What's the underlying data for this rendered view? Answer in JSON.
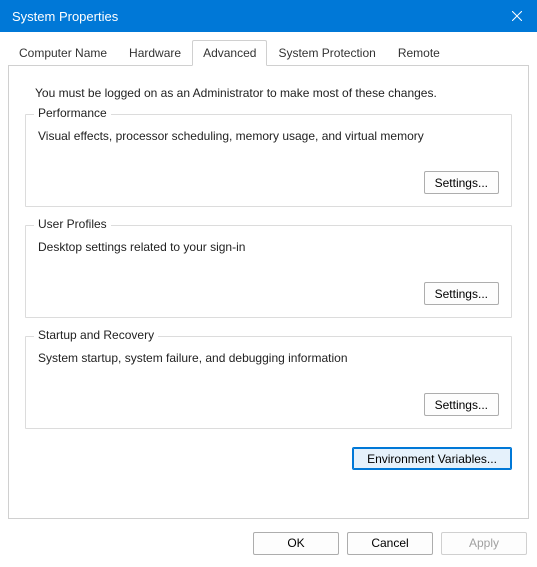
{
  "window": {
    "title": "System Properties"
  },
  "tabs": [
    {
      "label": "Computer Name"
    },
    {
      "label": "Hardware"
    },
    {
      "label": "Advanced",
      "active": true
    },
    {
      "label": "System Protection"
    },
    {
      "label": "Remote"
    }
  ],
  "page": {
    "intro": "You must be logged on as an Administrator to make most of these changes.",
    "groups": {
      "performance": {
        "legend": "Performance",
        "desc": "Visual effects, processor scheduling, memory usage, and virtual memory",
        "button": "Settings..."
      },
      "user_profiles": {
        "legend": "User Profiles",
        "desc": "Desktop settings related to your sign-in",
        "button": "Settings..."
      },
      "startup": {
        "legend": "Startup and Recovery",
        "desc": "System startup, system failure, and debugging information",
        "button": "Settings..."
      }
    },
    "env_button": "Environment Variables..."
  },
  "footer": {
    "ok": "OK",
    "cancel": "Cancel",
    "apply": "Apply"
  }
}
